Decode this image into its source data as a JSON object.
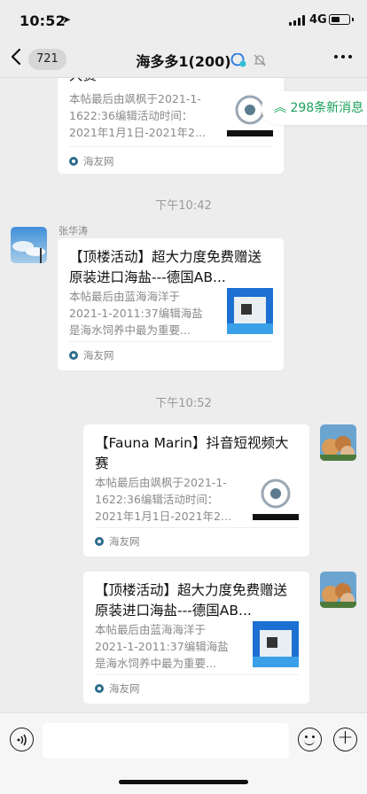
{
  "status": {
    "time": "10:52",
    "network": "4G"
  },
  "nav": {
    "back_count": "721",
    "title": "海多多1(200)"
  },
  "new_messages": "298条新消息",
  "messages": [
    {
      "title_partial": "大赛",
      "desc": [
        "本帖最后由飒枫于2021-1-",
        "1622:36编辑活动时间：",
        "2021年1月1日-2021年2..."
      ],
      "source": "海友网"
    },
    {
      "timestamp": "下午10:42",
      "sender": "张华涛",
      "title": "【顶楼活动】超大力度免费赠送原装进口海盐---德国AB...",
      "desc": [
        "本帖最后由蓝海海洋于",
        "2021-1-2011:37编辑海盐",
        "是海水饲养中最为重要..."
      ],
      "source": "海友网"
    },
    {
      "timestamp": "下午10:52",
      "title": "【Fauna Marin】抖音短视频大赛",
      "desc": [
        "本帖最后由飒枫于2021-1-",
        "1622:36编辑活动时间：",
        "2021年1月1日-2021年2..."
      ],
      "source": "海友网"
    },
    {
      "title": "【顶楼活动】超大力度免费赠送原装进口海盐---德国AB...",
      "desc": [
        "本帖最后由蓝海海洋于",
        "2021-1-2011:37编辑海盐",
        "是海水饲养中最为重要..."
      ],
      "source": "海友网"
    }
  ],
  "icons": {
    "back": "chevron-left-icon",
    "more": "more-dots-icon",
    "voice": "voice-icon",
    "emoji": "emoji-icon",
    "plus": "plus-icon",
    "source": "site-logo-icon"
  }
}
